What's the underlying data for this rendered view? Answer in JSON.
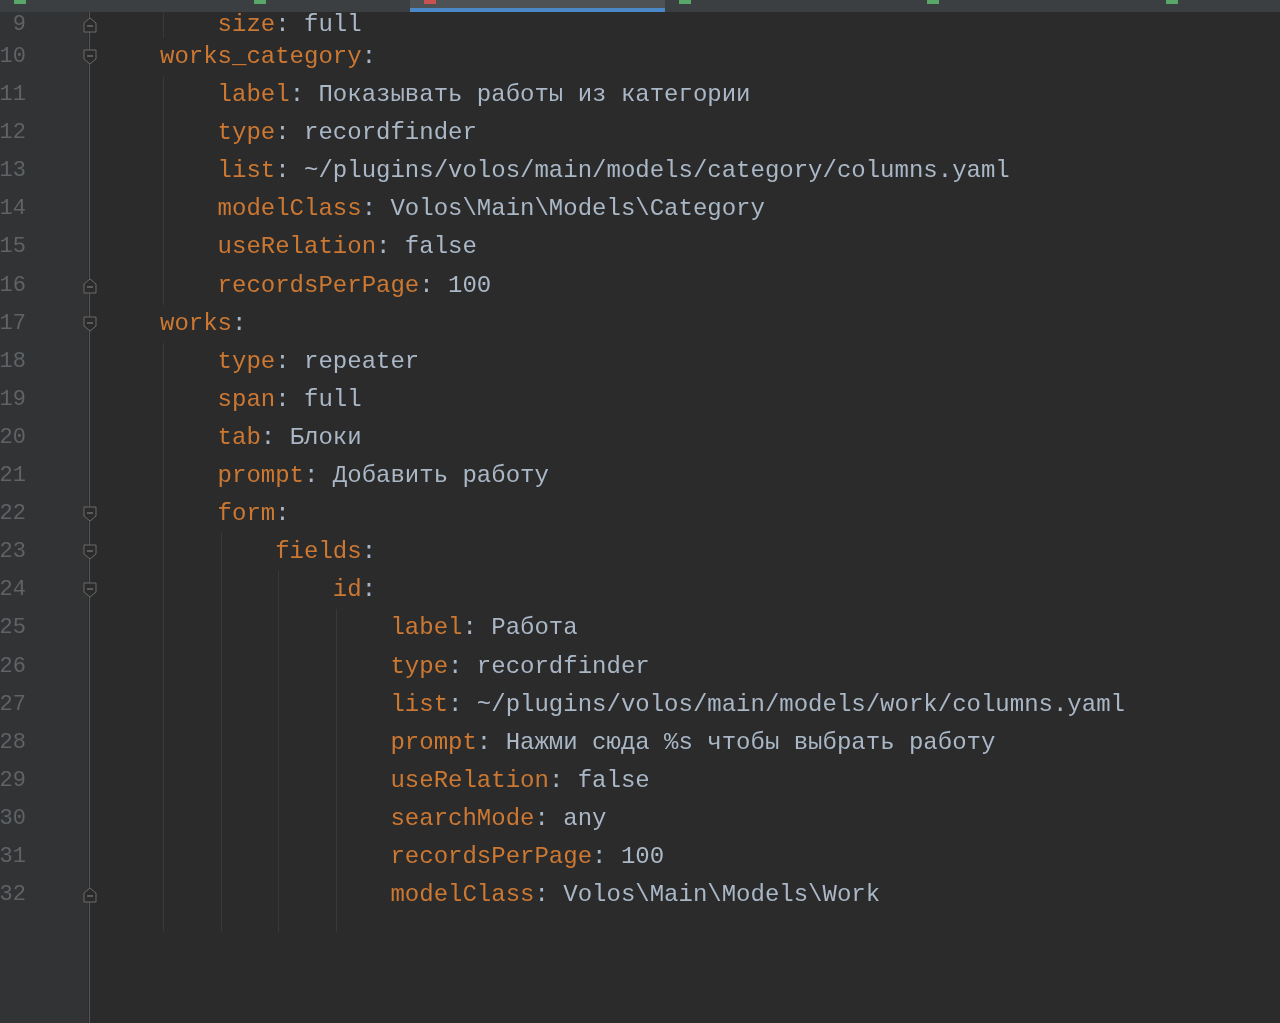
{
  "tabs": [
    {
      "selected": false,
      "color": "#59a869"
    },
    {
      "selected": false,
      "color": "#59a869"
    },
    {
      "selected": true,
      "color": "#c75450"
    },
    {
      "selected": false,
      "color": "#59a869"
    },
    {
      "selected": false,
      "color": "#59a869"
    },
    {
      "selected": false,
      "color": "#59a869"
    }
  ],
  "lines": [
    {
      "children": [
        {
          "number": "9",
          "text": "size: full",
          "fold_end": true
        }
      ]
    },
    {
      "number": "10",
      "text": "works_category:",
      "fold_start": true,
      "children": [
        {
          "number": "11",
          "text": "label: Показывать работы из категории"
        },
        {
          "number": "12",
          "text": "type: recordfinder"
        },
        {
          "number": "13",
          "text": "list: ~/plugins/volos/main/models/category/columns.yaml"
        },
        {
          "number": "14",
          "text": "modelClass: Volos\\Main\\Models\\Category"
        },
        {
          "number": "15",
          "text": "useRelation: false"
        },
        {
          "number": "16",
          "text": "recordsPerPage: 100",
          "fold_end": true
        }
      ]
    },
    {
      "number": "17",
      "text": "works:",
      "fold_start": true,
      "children": [
        {
          "number": "18",
          "text": "type: repeater"
        },
        {
          "number": "19",
          "text": "span: full"
        },
        {
          "number": "20",
          "text": "tab: Блоки"
        },
        {
          "number": "21",
          "text": "prompt: Добавить работу"
        },
        {
          "number": "22",
          "text": "form:",
          "fold_start": true,
          "children": [
            {
              "number": "23",
              "text": "fields:",
              "fold_start": true,
              "children": [
                {
                  "number": "24",
                  "text": "id:",
                  "fold_start": true,
                  "children": [
                    {
                      "number": "25",
                      "text": "label: Работа"
                    },
                    {
                      "number": "26",
                      "text": "type: recordfinder"
                    },
                    {
                      "number": "27",
                      "text": "list: ~/plugins/volos/main/models/work/columns.yaml"
                    },
                    {
                      "number": "28",
                      "text": "prompt: Нажми сюда %s чтобы выбрать работу"
                    },
                    {
                      "number": "29",
                      "text": "useRelation: false"
                    },
                    {
                      "number": "30",
                      "text": "searchMode: any"
                    },
                    {
                      "number": "31",
                      "text": "recordsPerPage: 100"
                    },
                    {
                      "number": "32",
                      "text": "modelClass: Volos\\Main\\Models\\Work",
                      "fold_end": true
                    }
                  ]
                }
              ]
            }
          ]
        }
      ]
    }
  ]
}
